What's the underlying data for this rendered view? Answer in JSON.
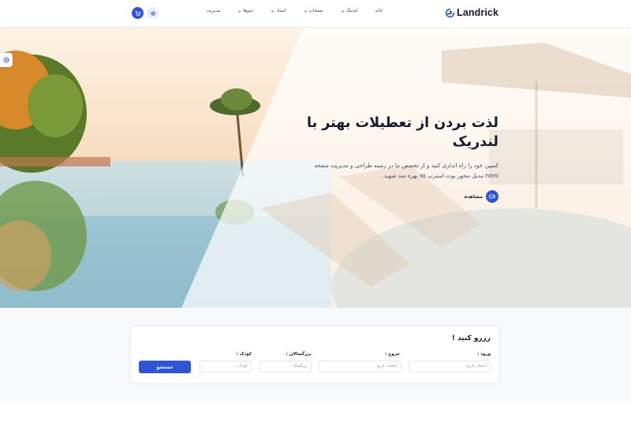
{
  "brand": {
    "name": "Landrick",
    "color": "#2f55d4"
  },
  "nav": {
    "items": [
      {
        "label": "خانه",
        "has_dropdown": false
      },
      {
        "label": "لندینگ",
        "has_dropdown": true
      },
      {
        "label": "صفحات",
        "has_dropdown": true
      },
      {
        "label": "اسناد",
        "has_dropdown": true
      },
      {
        "label": "دموها",
        "has_dropdown": true
      },
      {
        "label": "مدیریت",
        "has_dropdown": false
      }
    ],
    "cart_icon": "cart-icon",
    "settings_icon": "gear-icon"
  },
  "hero": {
    "title_line1": "لذت بردن از تعطیلات بهتر با",
    "title_line2": "لندریک",
    "desc_line1": "کمپین خود را راه اندازی کنید و از تخصص ما در زمینه طراحی و مدیریت صفحه",
    "desc_line2": "html تبدیل محور بوت استرپ ۷۵ بهره مند شوید.",
    "watch_label": "مشاهده",
    "watch_icon": "video-icon"
  },
  "booking": {
    "title": "رزرو کنید !",
    "checkin": {
      "label": "ورود :",
      "placeholder": "انتخاب تاریخ :"
    },
    "checkout": {
      "label": "خروج :",
      "placeholder": "انتخاب تاریخ"
    },
    "adults": {
      "label": "بزرگسالان :",
      "placeholder": "بزرگسال :"
    },
    "children": {
      "label": "کودک :",
      "placeholder": "کودک :"
    },
    "search_label": "جستجو"
  }
}
